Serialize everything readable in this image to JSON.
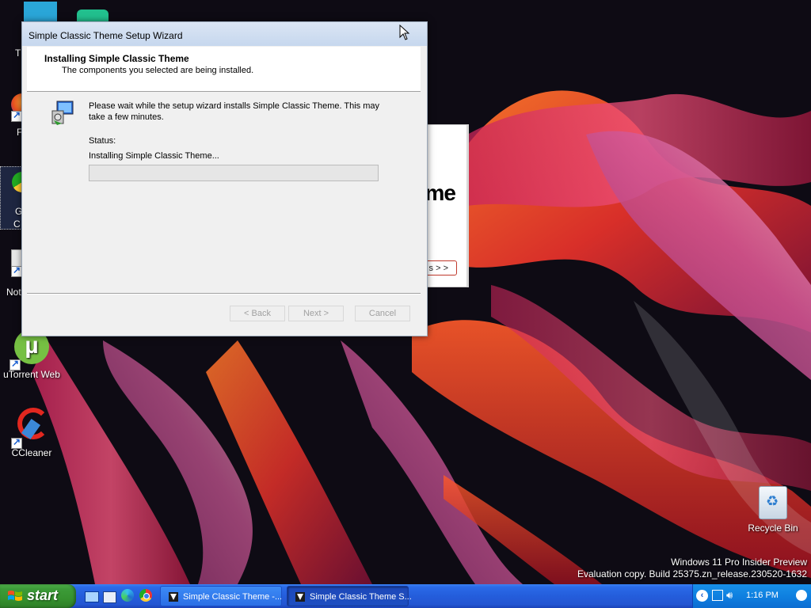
{
  "desktop": {
    "icons": [
      {
        "label": "uTorrent Web"
      },
      {
        "label": "CCleaner"
      },
      {
        "label": "Recycle Bin"
      }
    ],
    "partial_labels": [
      "T",
      "F",
      "G",
      "C",
      "Not"
    ],
    "watermark": {
      "line1": "Windows 11 Pro Insider Preview",
      "line2": "Evaluation copy. Build 25375.zn_release.230520-1632"
    }
  },
  "background_window": {
    "partial_title": "me",
    "partial_button": "s > >"
  },
  "wizard": {
    "title": "Simple Classic Theme Setup Wizard",
    "header_title": "Installing Simple Classic Theme",
    "header_subtitle": "The components you selected are being installed.",
    "message": "Please wait while the setup wizard installs Simple Classic Theme. This may take a few minutes.",
    "status_label": "Status:",
    "status_text": "Installing Simple Classic Theme...",
    "progress": 0,
    "buttons": {
      "back": "< Back",
      "next": "Next >",
      "cancel": "Cancel"
    }
  },
  "taskbar": {
    "start_label": "start",
    "quick_launch": [
      "show-desktop-icon",
      "explorer-icon",
      "edge-icon",
      "chrome-icon"
    ],
    "tasks": [
      {
        "label": "Simple Classic Theme -..."
      },
      {
        "label": "Simple Classic Theme S..."
      }
    ],
    "clock": "1:16 PM"
  },
  "colors": {
    "taskbar_blue": "#245ddb",
    "start_green": "#3c9b38",
    "tray_blue": "#0f80e0",
    "titlebar": "#c6d7ee"
  }
}
